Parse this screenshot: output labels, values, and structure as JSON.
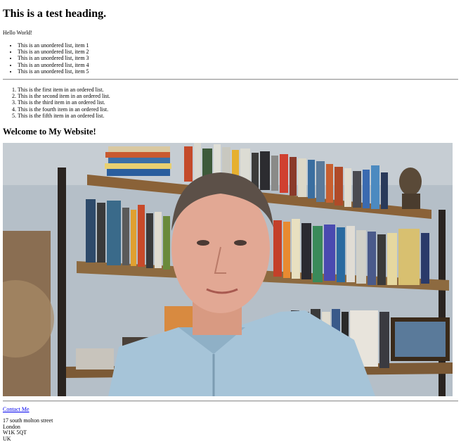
{
  "heading": "This is a test heading.",
  "greeting": "Hello World!",
  "unordered_items": [
    "This is an unordered list, item 1",
    "This is an unordered list, item 2",
    "This is an unordered list, item 3",
    "This is an unordered list, item 4",
    "This is an unordered list, item 5"
  ],
  "ordered_items": [
    "This is the first item in an ordered list.",
    "This is the second item in an ordered list.",
    "This is the third item in an ordered list.",
    "This is the fourth item in an ordered list.",
    "This is the fifth item in an ordered list."
  ],
  "welcome_heading": "Welcome to My Website!",
  "contact_link": "Contact Me",
  "address": {
    "line1": "17 south molton street",
    "line2": "London",
    "line3": "W1K 5QT",
    "line4": "UK"
  },
  "colors": {
    "link": "#0000ee",
    "rule": "#9a9a9a"
  }
}
